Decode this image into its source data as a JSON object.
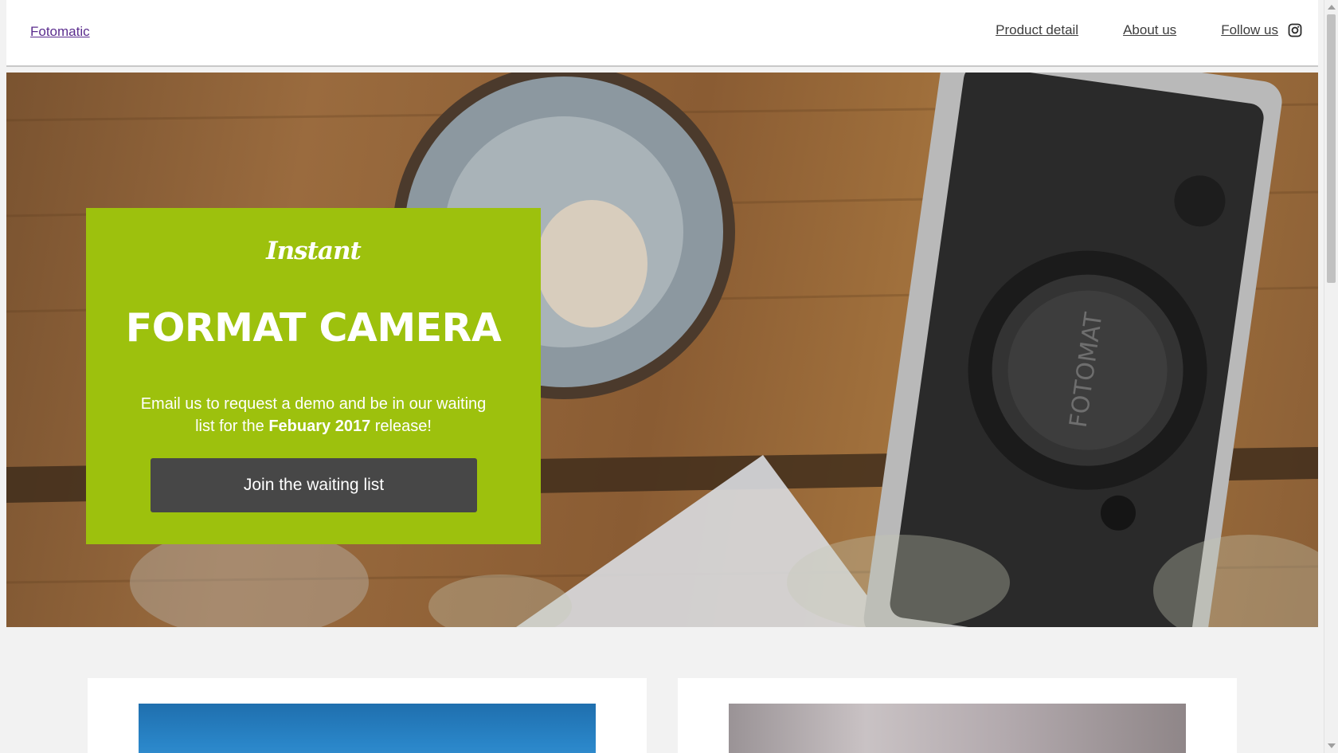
{
  "header": {
    "brand": "Fotomatic",
    "nav": [
      {
        "label": "Product detail"
      },
      {
        "label": "About us"
      },
      {
        "label": "Follow us"
      }
    ],
    "social_icon": "instagram-icon"
  },
  "hero": {
    "background": "camera-on-wooden-table-photo",
    "promo": {
      "script_text": "Instant",
      "title": "FORMAT CAMERA",
      "text_before": "Email us to request a demo and be in our waiting list for the ",
      "text_bold": "Febuary 2017",
      "text_after": " release!",
      "button_label": "Join the waiting list"
    }
  },
  "cards": [
    {
      "image": "sky-photo"
    },
    {
      "image": "camera-closeup-photo"
    }
  ],
  "colors": {
    "promo_background": "#9dc10d",
    "button_background": "#474747",
    "page_background": "#f2f2f2",
    "link_color": "#5b2d8e"
  }
}
